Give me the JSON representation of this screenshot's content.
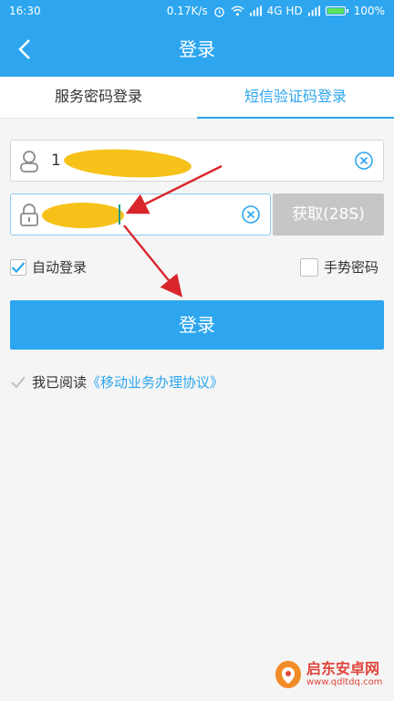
{
  "status_bar": {
    "time": "16:30",
    "speed": "0.17K/s",
    "network": "4G HD",
    "battery": "100%"
  },
  "header": {
    "title": "登录"
  },
  "tabs": [
    {
      "label": "服务密码登录",
      "active": false
    },
    {
      "label": "短信验证码登录",
      "active": true
    }
  ],
  "phone_field": {
    "value": "1"
  },
  "code_button": {
    "label": "获取(28S)"
  },
  "options": {
    "auto_login": {
      "label": "自动登录",
      "checked": true
    },
    "gesture_password": {
      "label": "手势密码",
      "checked": false
    }
  },
  "login_button": {
    "label": "登录"
  },
  "agreement": {
    "prefix": "我已阅读",
    "link": "《移动业务办理协议》",
    "checked": true
  },
  "watermark": {
    "name": "启东安卓网",
    "url": "www.qdltdq.com"
  },
  "colors": {
    "accent": "#2da6ef",
    "disabled_button": "#c6c6c6",
    "annotation": "#d9262c",
    "scribble": "#f6c21a"
  },
  "icons": [
    "back-arrow-icon",
    "user-icon",
    "lock-icon",
    "clear-icon",
    "check-icon",
    "wifi-icon",
    "alarm-icon",
    "signal-icon",
    "battery-icon"
  ]
}
